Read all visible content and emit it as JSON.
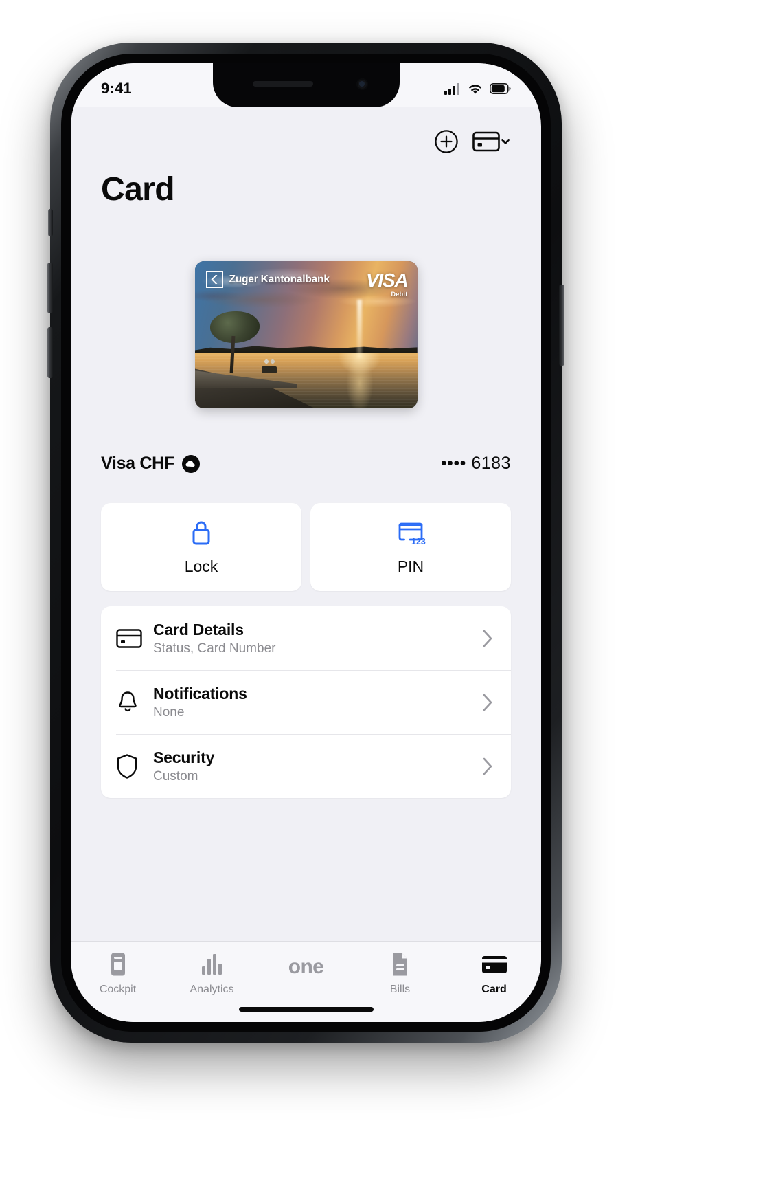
{
  "status_bar": {
    "time": "9:41",
    "signal_icon": "cellular-signal-icon",
    "wifi_icon": "wifi-icon",
    "battery_icon": "battery-icon"
  },
  "header": {
    "title": "Card",
    "add_icon": "plus-circle-icon",
    "switch_card_icon": "credit-card-chevron-icon"
  },
  "card": {
    "bank_name": "Zuger Kantonalbank",
    "bank_mark_icon": "zkb-chevron-mark-icon",
    "network_brand": "VISA",
    "network_type": "Debit",
    "artwork_description": "Lake sunset with tree and fountain",
    "name": "Visa CHF",
    "badge_icon": "cloud-circle-icon",
    "masked_number": "•••• 6183"
  },
  "quick_actions": [
    {
      "label": "Lock",
      "icon": "lock-icon",
      "color": "#2b6cf6"
    },
    {
      "label": "PIN",
      "icon": "card-pin-123-icon",
      "color": "#2b6cf6"
    }
  ],
  "settings_rows": [
    {
      "title": "Card Details",
      "subtitle": "Status, Card Number",
      "icon": "credit-card-icon",
      "chevron": "chevron-right-icon"
    },
    {
      "title": "Notifications",
      "subtitle": "None",
      "icon": "bell-icon",
      "chevron": "chevron-right-icon"
    },
    {
      "title": "Security",
      "subtitle": "Custom",
      "icon": "shield-icon",
      "chevron": "chevron-right-icon"
    }
  ],
  "tab_bar": {
    "items": [
      {
        "label": "Cockpit",
        "icon": "cockpit-icon",
        "active": false
      },
      {
        "label": "Analytics",
        "icon": "bar-chart-icon",
        "active": false
      },
      {
        "label": "one",
        "icon": "one-wordmark",
        "active": false
      },
      {
        "label": "Bills",
        "icon": "document-icon",
        "active": false
      },
      {
        "label": "Card",
        "icon": "card-filled-icon",
        "active": true
      }
    ]
  },
  "colors": {
    "accent": "#2b6cf6",
    "screen_bg": "#f0f0f5",
    "surface": "#ffffff",
    "text_primary": "#0a0a0a",
    "text_secondary": "#8b8b90"
  }
}
